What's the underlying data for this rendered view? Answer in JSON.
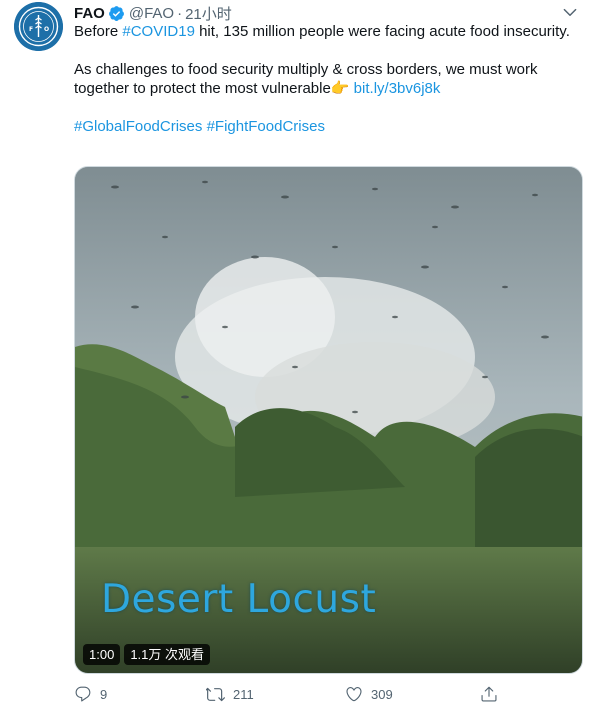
{
  "tweet": {
    "author_name": "FAO",
    "handle": "@FAO",
    "separator": "·",
    "time": "21小时",
    "text_line1_prefix": "Before ",
    "hashtag_covid": "#COVID19",
    "text_line1_rest": " hit, 135 million people were facing acute food insecurity.",
    "text_para2": "As challenges to food security multiply & cross borders, we must work together to protect the most vulnerable",
    "emoji": "👉",
    "link": " bit.ly/3bv6j8k",
    "hashtag_1": "#GlobalFoodCrises",
    "hashtag_2": "#FightFoodCrises"
  },
  "media": {
    "overlay_title": "Desert Locust",
    "duration": "1:00",
    "views": "1.1万 次观看"
  },
  "actions": {
    "reply_count": "9",
    "retweet_count": "211",
    "like_count": "309"
  },
  "colors": {
    "link": "#1b95e0",
    "verified": "#1d9bf0",
    "secondary_text": "#536471",
    "avatar_bg": "#1d6fa8"
  },
  "icons": [
    "verified-badge-icon",
    "more-icon",
    "reply-icon",
    "retweet-icon",
    "like-icon",
    "share-icon"
  ]
}
